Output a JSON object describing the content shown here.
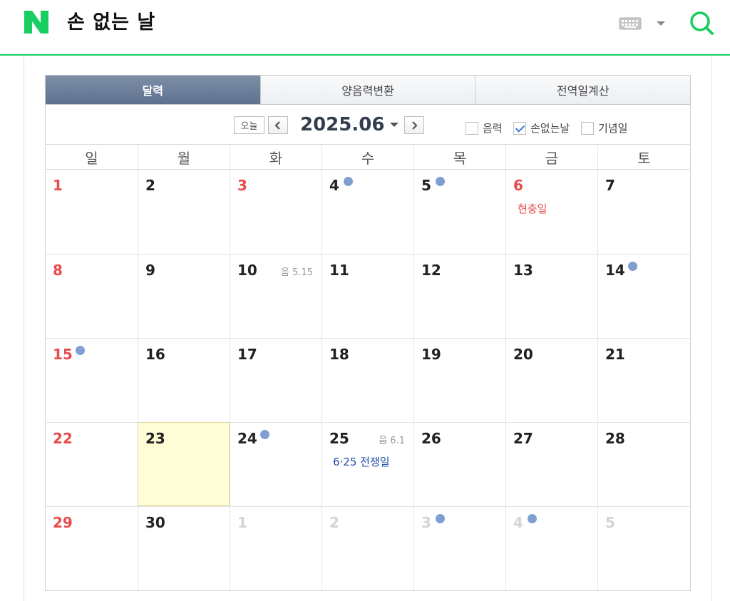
{
  "header": {
    "title": "손 없는 날",
    "icons": {
      "logo": "naver-n-logo",
      "keyboard": "keyboard-icon",
      "dropdown": "caret-down-icon",
      "search": "search-icon"
    },
    "accent_color": "#19ce60"
  },
  "tabs": [
    {
      "label": "달력",
      "active": true
    },
    {
      "label": "양음력변환",
      "active": false
    },
    {
      "label": "전역일계산",
      "active": false
    }
  ],
  "controls": {
    "today_label": "오늘",
    "month_label": "2025.06",
    "options": [
      {
        "label": "음력",
        "checked": false
      },
      {
        "label": "손없는날",
        "checked": true
      },
      {
        "label": "기념일",
        "checked": false
      }
    ]
  },
  "weekdays": [
    "일",
    "월",
    "화",
    "수",
    "목",
    "금",
    "토"
  ],
  "weeks": [
    [
      {
        "day": "1",
        "type": "holiday"
      },
      {
        "day": "2",
        "type": "normal"
      },
      {
        "day": "3",
        "type": "holiday"
      },
      {
        "day": "4",
        "type": "normal",
        "dot": true
      },
      {
        "day": "5",
        "type": "normal",
        "dot": true
      },
      {
        "day": "6",
        "type": "holiday",
        "event": "현충일",
        "event_color": "red"
      },
      {
        "day": "7",
        "type": "normal"
      }
    ],
    [
      {
        "day": "8",
        "type": "holiday"
      },
      {
        "day": "9",
        "type": "normal"
      },
      {
        "day": "10",
        "type": "normal",
        "lunar": "음 5.15"
      },
      {
        "day": "11",
        "type": "normal"
      },
      {
        "day": "12",
        "type": "normal"
      },
      {
        "day": "13",
        "type": "normal"
      },
      {
        "day": "14",
        "type": "normal",
        "dot": true
      }
    ],
    [
      {
        "day": "15",
        "type": "holiday",
        "dot": true
      },
      {
        "day": "16",
        "type": "normal"
      },
      {
        "day": "17",
        "type": "normal"
      },
      {
        "day": "18",
        "type": "normal"
      },
      {
        "day": "19",
        "type": "normal"
      },
      {
        "day": "20",
        "type": "normal"
      },
      {
        "day": "21",
        "type": "normal"
      }
    ],
    [
      {
        "day": "22",
        "type": "holiday"
      },
      {
        "day": "23",
        "type": "normal",
        "today": true
      },
      {
        "day": "24",
        "type": "normal",
        "dot": true
      },
      {
        "day": "25",
        "type": "normal",
        "lunar": "음 6.1",
        "event": "6·25 전쟁일",
        "event_color": "blue"
      },
      {
        "day": "26",
        "type": "normal"
      },
      {
        "day": "27",
        "type": "normal"
      },
      {
        "day": "28",
        "type": "normal"
      }
    ],
    [
      {
        "day": "29",
        "type": "holiday"
      },
      {
        "day": "30",
        "type": "normal"
      },
      {
        "day": "1",
        "type": "other"
      },
      {
        "day": "2",
        "type": "other"
      },
      {
        "day": "3",
        "type": "other",
        "dot": true
      },
      {
        "day": "4",
        "type": "other",
        "dot": true
      },
      {
        "day": "5",
        "type": "other"
      }
    ]
  ]
}
